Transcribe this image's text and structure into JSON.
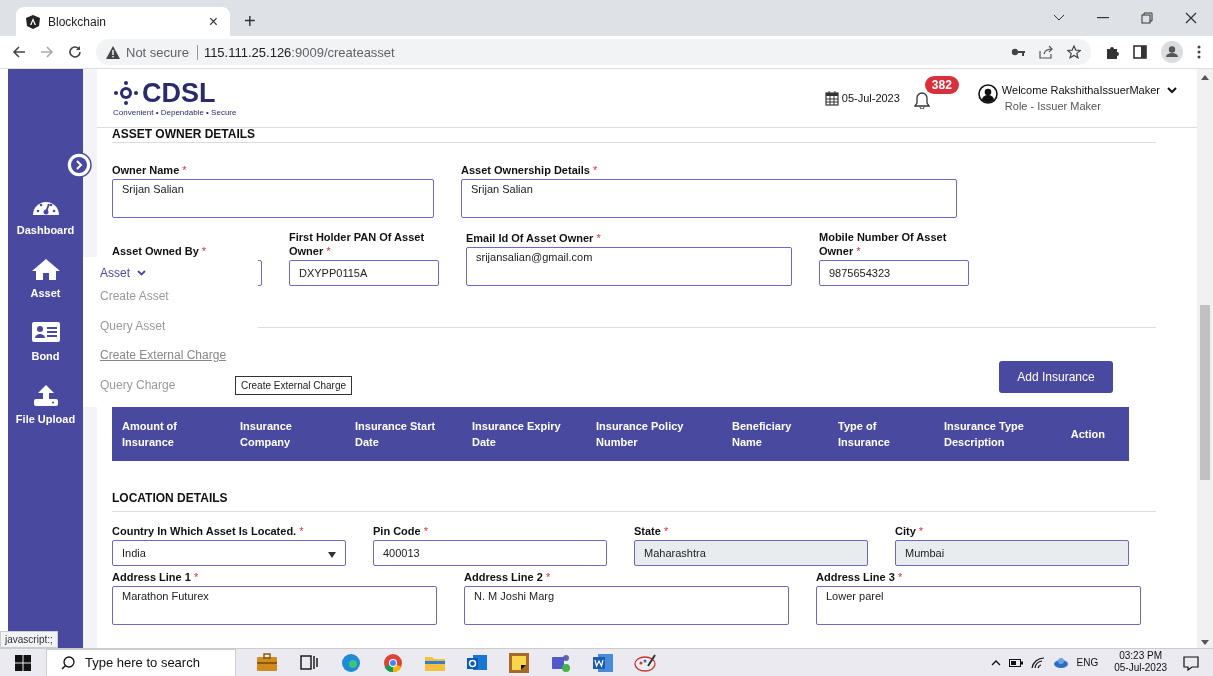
{
  "browser": {
    "tab_title": "Blockchain",
    "tab_close": "×",
    "new_tab": "+",
    "security": "Not secure",
    "url_host": "115.111.25.126",
    "url_path": ":9009/createasset",
    "status_text": "javascript:;"
  },
  "header": {
    "logo_text": "CDSL",
    "logo_tagline": "Convenient • Dependable • Secure",
    "date": "05-Jul-2023",
    "notification_count": "382",
    "welcome": "Welcome RakshithaIssuerMaker",
    "role": "Role - Issuer Maker"
  },
  "sidebar": {
    "items": [
      {
        "label": "Dashboard",
        "kind": "dashboard"
      },
      {
        "label": "Asset",
        "kind": "home"
      },
      {
        "label": "Bond",
        "kind": "card"
      },
      {
        "label": "File Upload",
        "kind": "upload"
      }
    ]
  },
  "asset_menu": {
    "title": "Asset",
    "items": [
      {
        "label": "Create Asset",
        "hovered": false
      },
      {
        "label": "Query Asset",
        "hovered": false
      },
      {
        "label": "Create External Charge",
        "hovered": true
      },
      {
        "label": "Query Charge",
        "hovered": false
      }
    ],
    "tooltip": "Create External Charge"
  },
  "owner_section": {
    "title": "ASSET OWNER DETAILS",
    "fields": [
      {
        "label": "Owner Name",
        "mark": "*",
        "kind": "textarea",
        "value": "Srijan Salian"
      },
      {
        "label": "Asset Ownership Details",
        "mark": "*",
        "kind": "textarea",
        "value": "Srijan Salian"
      },
      {
        "label": "Asset Owned By",
        "mark": "*",
        "kind": "text"
      },
      {
        "label": "First Holder PAN Of Asset Owner",
        "mark": "*",
        "kind": "text",
        "value": "DXYPP0115A"
      },
      {
        "label": "Email Id Of Asset Owner",
        "mark": "*",
        "kind": "textarea",
        "value": "srijansalian@gmail.com"
      },
      {
        "label": "Mobile Number Of Asset Owner",
        "mark": "*",
        "kind": "text",
        "value": "9875654323"
      }
    ]
  },
  "insurance_section": {
    "button": "Add Insurance",
    "table": {
      "columns": [
        "Amount of Insurance",
        "Insurance Company",
        "Insurance Start Date",
        "Insurance Expiry Date",
        "Insurance Policy Number",
        "Beneficiary Name",
        "Type of Insurance",
        "Insurance Type Description",
        "Action"
      ]
    }
  },
  "location_section": {
    "title": "LOCATION DETAILS",
    "fields": [
      {
        "label": "Country In Which Asset Is Located.",
        "mark": "*",
        "kind": "select",
        "value": "India",
        "disabled": false
      },
      {
        "label": "Pin Code",
        "mark": "*",
        "kind": "text",
        "value": "400013",
        "disabled": false
      },
      {
        "label": "State",
        "mark": "*",
        "kind": "text",
        "value": "Maharashtra",
        "disabled": true
      },
      {
        "label": "City",
        "mark": "*",
        "kind": "text",
        "value": "Mumbai",
        "disabled": true
      },
      {
        "label": "Address Line 1",
        "mark": "*",
        "kind": "textarea",
        "value": "Marathon Futurex",
        "disabled": false
      },
      {
        "label": "Address Line 2",
        "mark": "*",
        "kind": "textarea",
        "value": "N. M Joshi Marg",
        "disabled": false
      },
      {
        "label": "Address Line 3",
        "mark": "*",
        "kind": "textarea",
        "value": "Lower parel",
        "disabled": false
      }
    ]
  },
  "taskbar": {
    "search_placeholder": "Type here to search",
    "language": "ENG",
    "time": "03:23 PM",
    "date": "05-Jul-2023"
  }
}
